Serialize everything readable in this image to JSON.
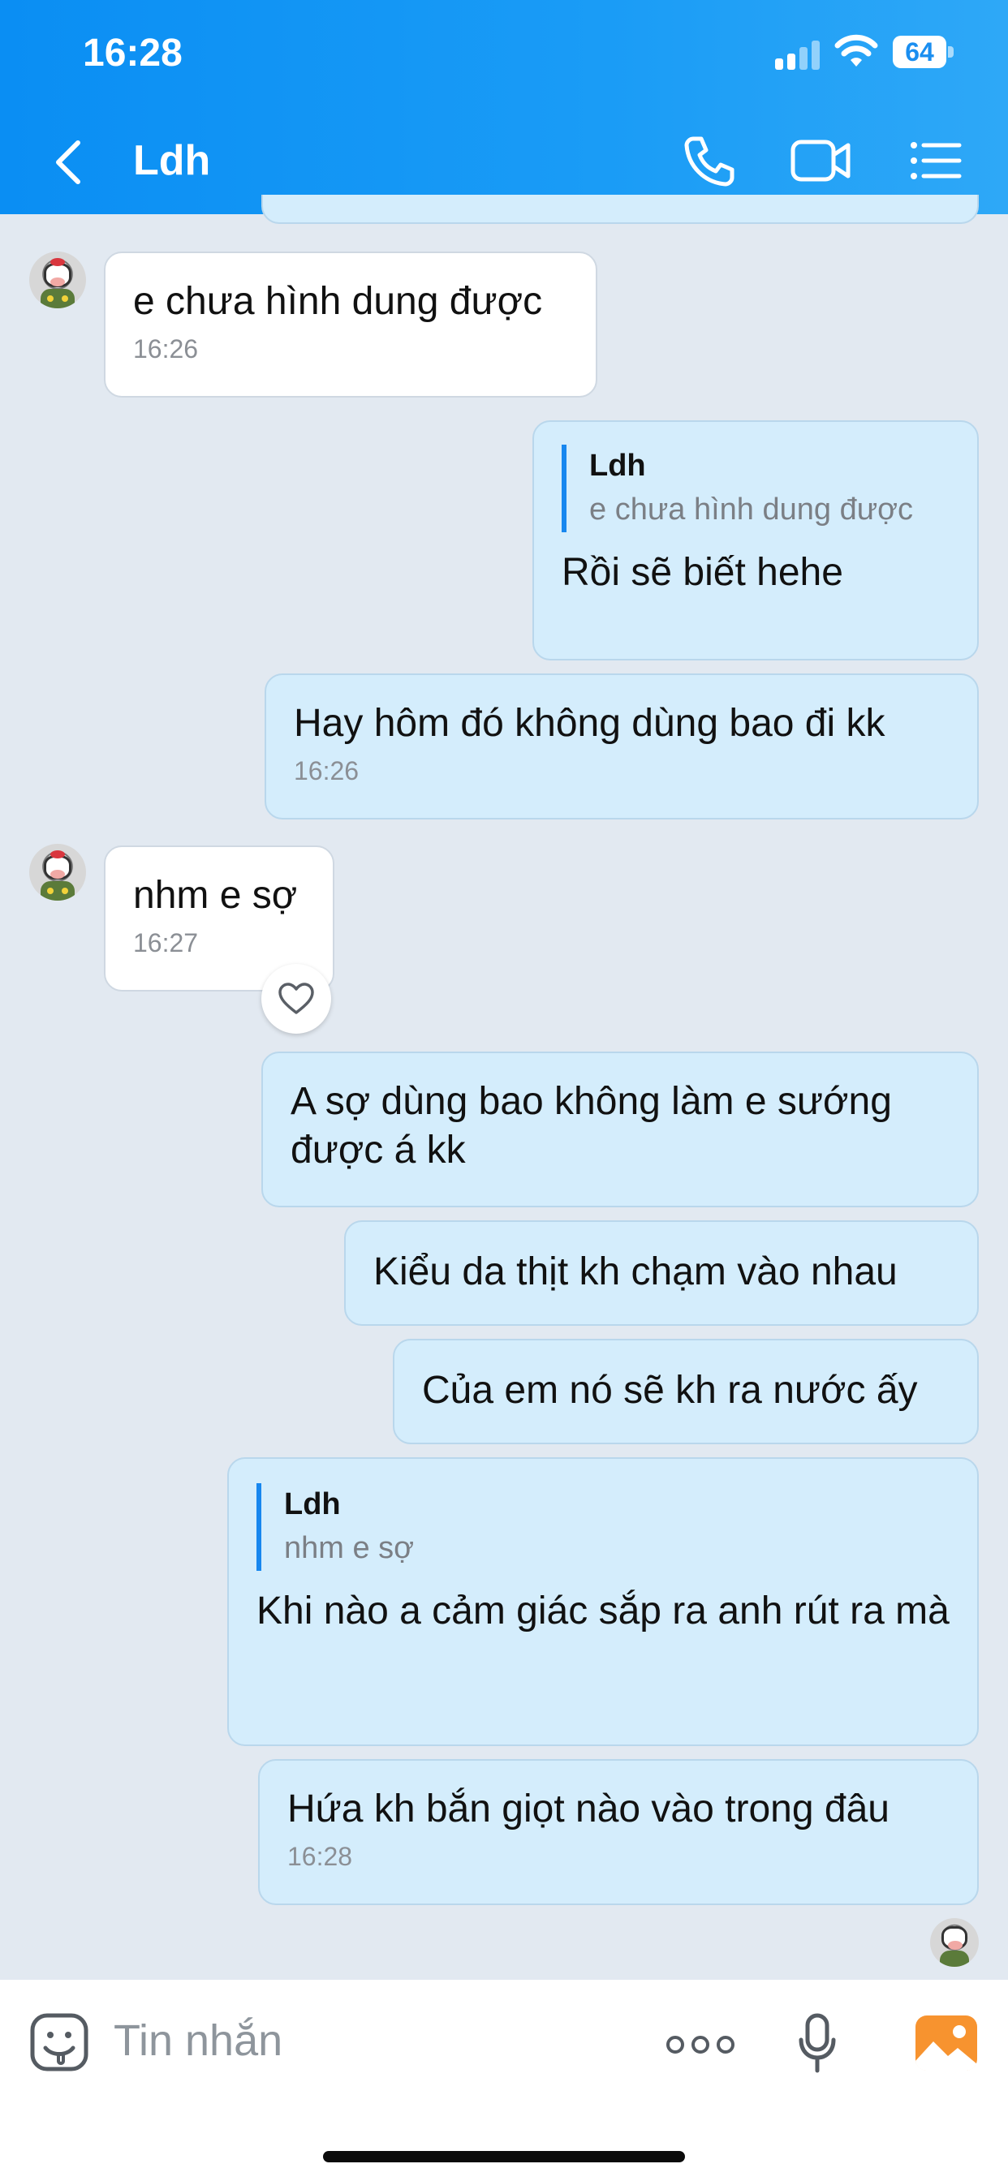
{
  "status_bar": {
    "time": "16:28",
    "battery": "64"
  },
  "header": {
    "title": "Ldh"
  },
  "messages": [
    {
      "text": "e chưa hình dung được",
      "time": "16:26"
    },
    {
      "quote_author": "Ldh",
      "quote_text": "e chưa hình dung được",
      "text": "Rồi sẽ biết hehe"
    },
    {
      "text": "Hay hôm đó không dùng bao đi kk",
      "time": "16:26"
    },
    {
      "text": "nhm e sợ",
      "time": "16:27"
    },
    {
      "text": "A sợ dùng bao không làm e sướng được á kk"
    },
    {
      "text": "Kiểu da thịt kh chạm vào nhau"
    },
    {
      "text": "Của em nó sẽ kh ra nước ấy"
    },
    {
      "quote_author": "Ldh",
      "quote_text": "nhm e sợ",
      "text": "Khi nào a cảm giác sắp ra anh rút ra mà"
    },
    {
      "text": "Hứa kh bắn giọt nào vào trong đâu",
      "time": "16:28"
    }
  ],
  "input": {
    "placeholder": "Tin nhắn"
  },
  "colors": {
    "header": "#0a8ef3",
    "background": "#e2e9f1",
    "outgoing_bubble": "#d4edfc",
    "incoming_bubble": "#ffffff",
    "accent": "#1787ef",
    "photo_button": "#f7932f"
  },
  "icons": [
    "back-chevron",
    "phone",
    "video-camera",
    "list-menu",
    "heart",
    "sticker-face",
    "more-dots",
    "microphone",
    "photo"
  ]
}
